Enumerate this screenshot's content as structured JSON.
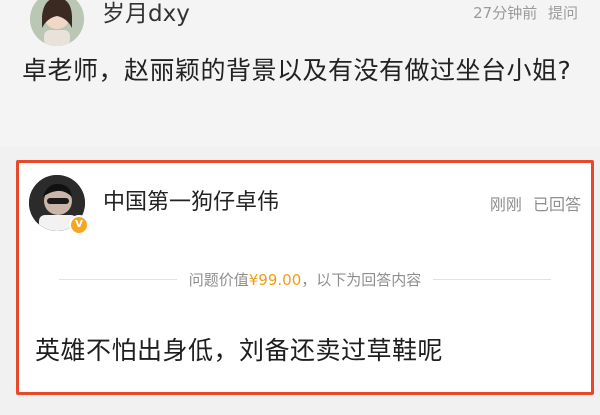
{
  "question": {
    "asker_name": "岁月dxy",
    "time": "27分钟前",
    "action": "提问",
    "text": "卓老师，赵丽颖的背景以及有没有做过坐台小姐?"
  },
  "answer": {
    "answerer_name": "中国第一狗仔卓伟",
    "time": "刚刚",
    "status": "已回答",
    "value_prefix": "问题价值",
    "value_amount": "¥99.00",
    "value_suffix": "，以下为回答内容",
    "text": "英雄不怕出身低，刘备还卖过草鞋呢"
  },
  "colors": {
    "highlight_border": "#e74a2a",
    "price": "#f39c12",
    "badge": "#f5a623"
  },
  "icons": {
    "verified": "verified-badge-icon"
  }
}
